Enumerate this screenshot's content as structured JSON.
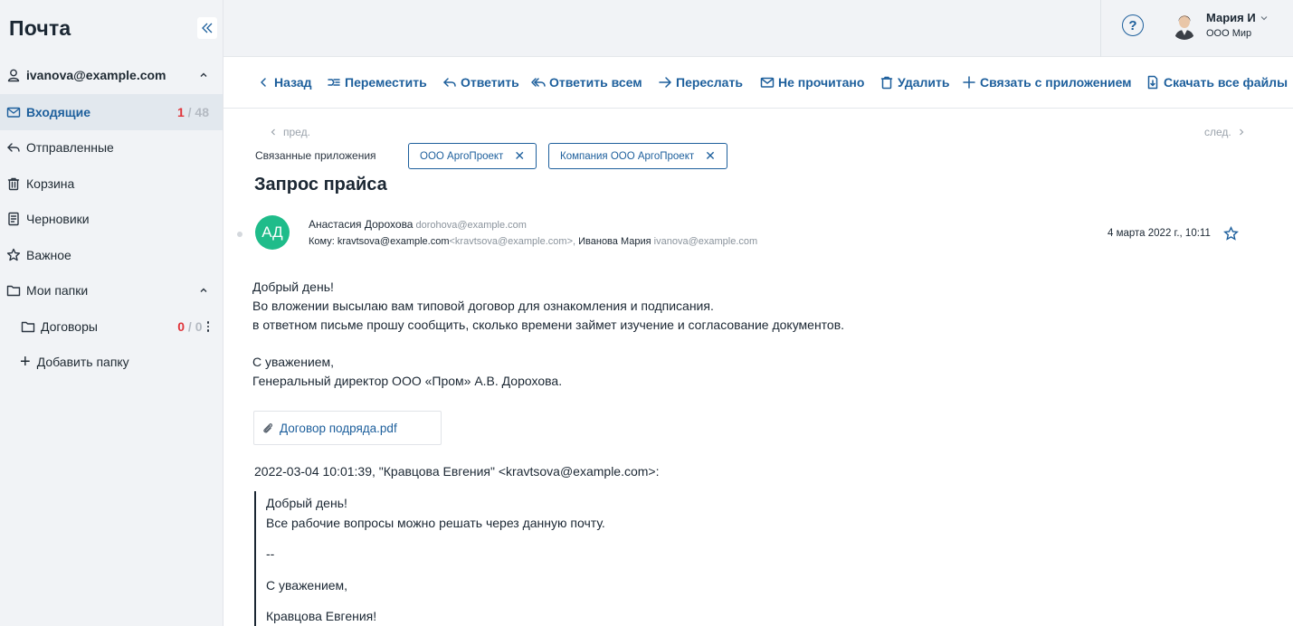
{
  "app": {
    "title": "Почта"
  },
  "sidebar": {
    "account": "ivanova@example.com",
    "folders": [
      {
        "label": "Входящие",
        "unread": "1",
        "sep": " / ",
        "total": "48",
        "icon": "envelope-icon"
      },
      {
        "label": "Отправленные",
        "icon": "reply-icon"
      },
      {
        "label": "Корзина",
        "icon": "trash-icon"
      },
      {
        "label": "Черновики",
        "icon": "draft-icon"
      },
      {
        "label": "Важное",
        "icon": "star-icon"
      }
    ],
    "my_folders": {
      "label": "Мои папки"
    },
    "subfolders": [
      {
        "label": "Договоры",
        "unread": "0",
        "sep": " / ",
        "total": "0"
      }
    ],
    "add_folder": "Добавить папку"
  },
  "header": {
    "user_name": "Мария И",
    "user_org": "ООО Мир",
    "help": "?"
  },
  "toolbar": {
    "back": "Назад",
    "move": "Переместить",
    "reply": "Ответить",
    "reply_all": "Ответить всем",
    "forward": "Переслать",
    "unread": "Не прочитано",
    "delete": "Удалить",
    "link_app": "Связать с приложением",
    "download_all": "Скачать все файлы"
  },
  "message": {
    "prev": "пред.",
    "next": "след.",
    "related_label": "Связанные приложения",
    "related": [
      "ООО АргоПроект",
      "Компания ООО АргоПроект"
    ],
    "subject": "Запрос прайса",
    "avatar_initials": "АД",
    "from_name": "Анастасия Дорохова",
    "from_email": "dorohova@example.com",
    "to_prefix": "Кому:",
    "to_1": "kravtsova@example.com",
    "to_1_full": "<kravtsova@example.com>,",
    "to_2": "Иванова Мария",
    "to_2_email": "ivanova@example.com",
    "date": "4 марта 2022 г., 10:11",
    "body": [
      "Добрый день!",
      "Во вложении высылаю вам типовой договор для ознакомления и подписания.",
      "в ответном письме прошу сообщить, сколько времени займет изучение и согласование документов.",
      "",
      "С уважением,",
      "Генеральный директор ООО «Пром» А.В. Дорохова."
    ],
    "attachment": "Договор подряда.pdf",
    "quote_header": "2022-03-04 10:01:39, \"Кравцова Евгения\" <kravtsova@example.com>:",
    "quote": [
      "Добрый день!",
      "Все рабочие вопросы можно решать через данную почту.",
      "--",
      "С уважением,",
      "Кравцова Евгения!"
    ]
  }
}
